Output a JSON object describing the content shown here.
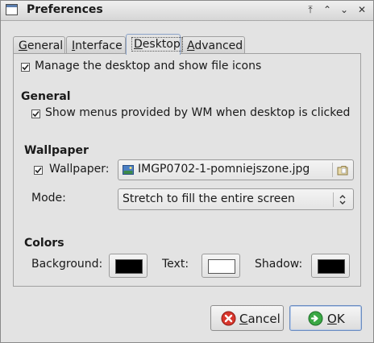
{
  "window": {
    "title": "Preferences",
    "controls": {
      "rollup": "⤒",
      "menu": "⌃",
      "minimize": "⌄",
      "close": "✕"
    }
  },
  "tabs": [
    {
      "label_u": "G",
      "label_rest": "eneral"
    },
    {
      "label_u": "I",
      "label_rest": "nterface"
    },
    {
      "label_u": "D",
      "label_rest": "esktop",
      "active": true
    },
    {
      "label_u": "A",
      "label_rest": "dvanced"
    }
  ],
  "desktop": {
    "manage_label": "Manage the desktop and show file icons",
    "manage_checked": true,
    "general_heading": "General",
    "show_menus_label": "Show menus provided by WM when desktop is clicked",
    "show_menus_checked": true,
    "wallpaper_heading": "Wallpaper",
    "wallpaper_label": "Wallpaper:",
    "wallpaper_checked": true,
    "wallpaper_file": "IMGP0702-1-pomniejszone.jpg",
    "mode_label": "Mode:",
    "mode_value": "Stretch to fill the entire screen",
    "colors_heading": "Colors",
    "background_label": "Background:",
    "text_label": "Text:",
    "shadow_label": "Shadow:"
  },
  "colors": {
    "background": "#000000",
    "text": "#ffffff",
    "shadow": "#000000",
    "cancel_icon": "#d8362c",
    "ok_icon": "#3aa845"
  },
  "buttons": {
    "cancel_u": "C",
    "cancel_rest": "ancel",
    "ok_u": "O",
    "ok_rest": "K"
  },
  "icons": {
    "window": "window-icon",
    "file": "image-file-icon",
    "folder": "folder-icon",
    "spinner": "combo-arrows-icon",
    "cancel": "cancel-icon",
    "ok": "ok-icon"
  }
}
